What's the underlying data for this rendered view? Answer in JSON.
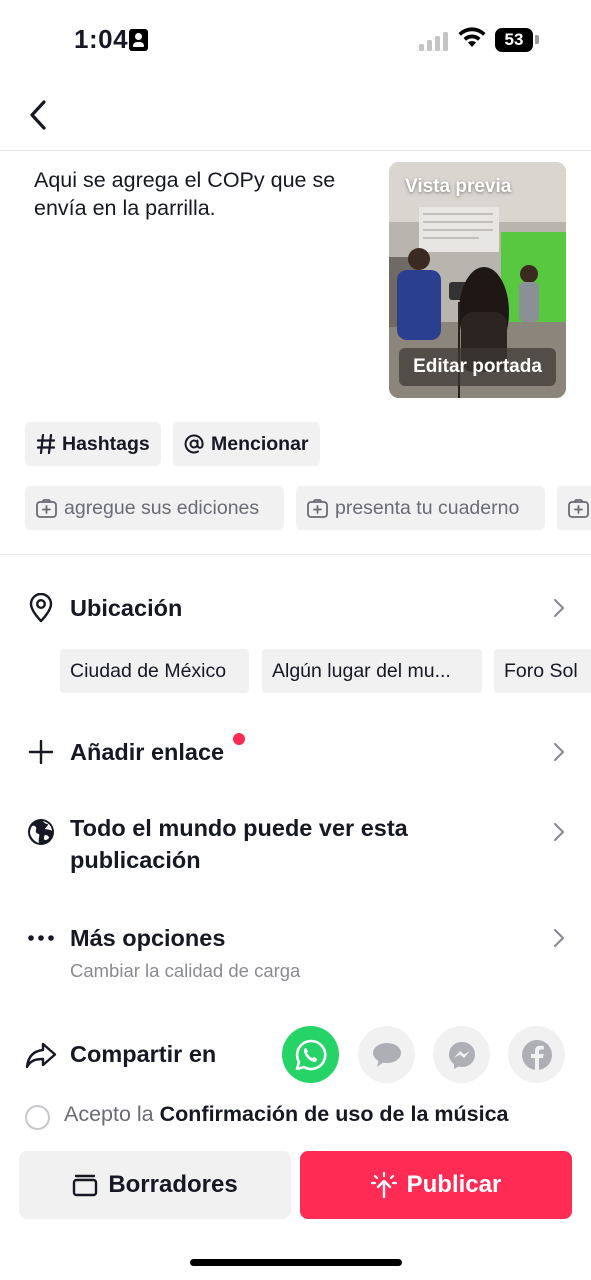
{
  "status_bar": {
    "time": "1:04",
    "battery": "53"
  },
  "nav": {
    "back_icon": "chevron-left-icon"
  },
  "post": {
    "caption": "Aqui se agrega el COPy que se envía en la parrilla.",
    "preview_label": "Vista previa",
    "edit_cover_label": "Editar portada"
  },
  "chips": {
    "hashtags": "Hashtags",
    "mention": "Mencionar",
    "suggestions": [
      "agregue sus ediciones",
      "presenta tu cuaderno"
    ]
  },
  "location": {
    "title": "Ubicación",
    "suggestions": [
      "Ciudad de México",
      "Algún lugar del mu...",
      "Foro Sol"
    ]
  },
  "add_link": {
    "title": "Añadir enlace"
  },
  "privacy": {
    "title": "Todo el mundo puede ver esta publicación"
  },
  "more_options": {
    "title": "Más opciones",
    "subtitle": "Cambiar la calidad de carga"
  },
  "share": {
    "title": "Compartir en",
    "targets": [
      "whatsapp-icon",
      "message-icon",
      "messenger-icon",
      "facebook-icon"
    ]
  },
  "agreement": {
    "prefix": "Acepto la ",
    "link": "Confirmación de uso de la música"
  },
  "actions": {
    "drafts": "Borradores",
    "publish": "Publicar"
  },
  "colors": {
    "primary": "#fe2c55",
    "whatsapp": "#25d366",
    "chip_bg": "#f1f1f2"
  }
}
